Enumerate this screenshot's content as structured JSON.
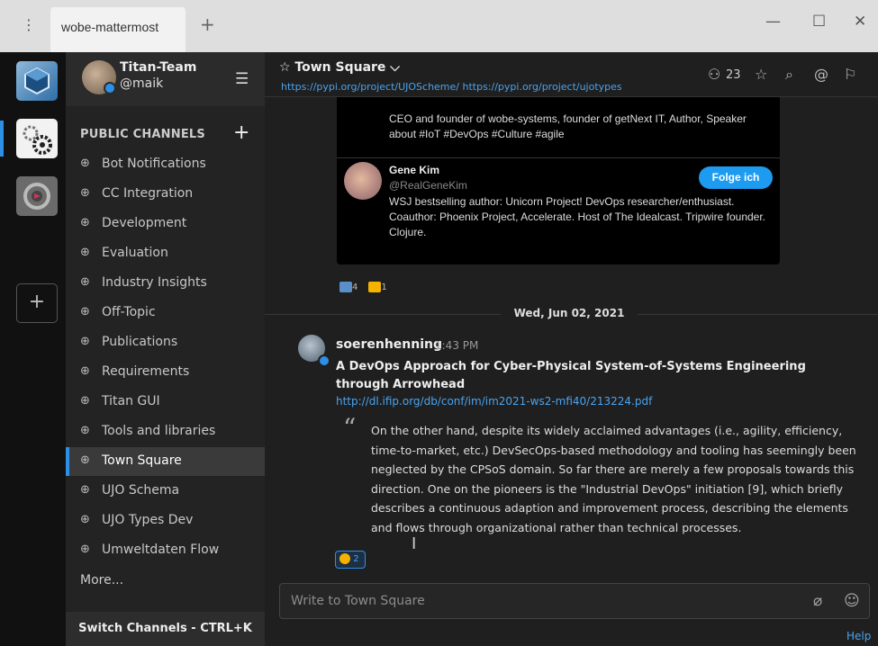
{
  "window": {
    "tab_title": "wobe-mattermost",
    "tab_add": "+",
    "menu_icon": "⋮",
    "minimize": "—",
    "maximize": "☐",
    "close": "✕"
  },
  "teams": {
    "add_label": "+"
  },
  "sidebar": {
    "team_name": "Titan-Team",
    "user_name": "@maik",
    "section_title": "PUBLIC CHANNELS",
    "section_add": "+",
    "channels": [
      "Bot Notifications",
      "CC Integration",
      "Development",
      "Evaluation",
      "Industry Insights",
      "Off-Topic",
      "Publications",
      "Requirements",
      "Titan GUI",
      "Tools and libraries",
      "Town Square",
      "UJO Schema",
      "UJO Types Dev",
      "Umweltdaten Flow"
    ],
    "active_channel": "Town Square",
    "more_label": "More...",
    "switch_label": "Switch Channels - CTRL+K"
  },
  "header": {
    "channel_title": "☆ Town Square ⌵",
    "purpose": "https://pypi.org/project/UJOScheme/ https://pypi.org/project/ujotypes",
    "member_count": "23"
  },
  "tweet_card": {
    "prev_bio": "CEO and founder of wobe-systems, founder of getNext IT, Author, Speaker about #IoT #DevOps #Culture #agile",
    "name": "Gene Kim",
    "handle": "@RealGeneKim",
    "bio": "WSJ bestselling author: Unicorn Project! DevOps researcher/enthusiast. Coauthor: Phoenix Project, Accelerate. Host of The Idealcast. Tripwire founder. Clojure.",
    "follow_label": "Folge ich"
  },
  "reactions_1": [
    {
      "emoji": "cool",
      "count": "4",
      "color": "#5b8fc9"
    },
    {
      "emoji": "thumbsup",
      "count": "1",
      "color": "#f5b300"
    }
  ],
  "date_separator": "Wed, Jun 02, 2021",
  "post": {
    "author": "soerenhenning",
    "time": "1:43 PM",
    "title": "A DevOps Approach for Cyber-Physical System-of-Systems Engineering through Arrowhead",
    "link": "http://dl.ifip.org/db/conf/im/im2021-ws2-mfi40/213224.pdf",
    "quote": "On the other hand, despite its widely acclaimed advantages (i.e., agility, efficiency, time-to-market, etc.) DevSecOps-based methodology and tooling has seemingly been neglected by the CPSoS domain. So far there are merely a few proposals towards this direction. One on the pioneers is the \"Industrial DevOps\" initiation [9], which briefly describes a continuous adaption and improvement process, describing the elements and flows through organizational rather than technical processes.",
    "reaction_count": "2"
  },
  "composer": {
    "placeholder": "Write to Town Square",
    "value": ""
  },
  "help_label": "Help",
  "colors": {
    "accent": "#2e8fe6",
    "link": "#4aa3f0"
  }
}
